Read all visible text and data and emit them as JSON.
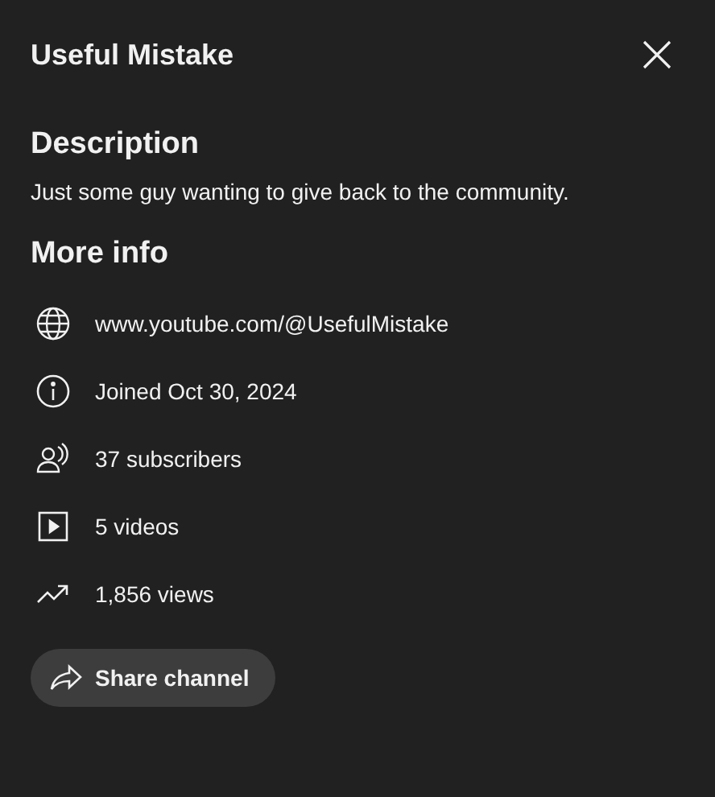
{
  "title": "Useful Mistake",
  "description": {
    "heading": "Description",
    "text": "Just some guy wanting to give back to the community."
  },
  "more_info": {
    "heading": "More info",
    "rows": [
      {
        "kind": "globe",
        "text": "www.youtube.com/@UsefulMistake"
      },
      {
        "kind": "info",
        "text": "Joined Oct 30, 2024"
      },
      {
        "kind": "people",
        "text": "37 subscribers"
      },
      {
        "kind": "video",
        "text": "5 videos"
      },
      {
        "kind": "trend",
        "text": "1,856 views"
      }
    ]
  },
  "share_button": "Share channel"
}
